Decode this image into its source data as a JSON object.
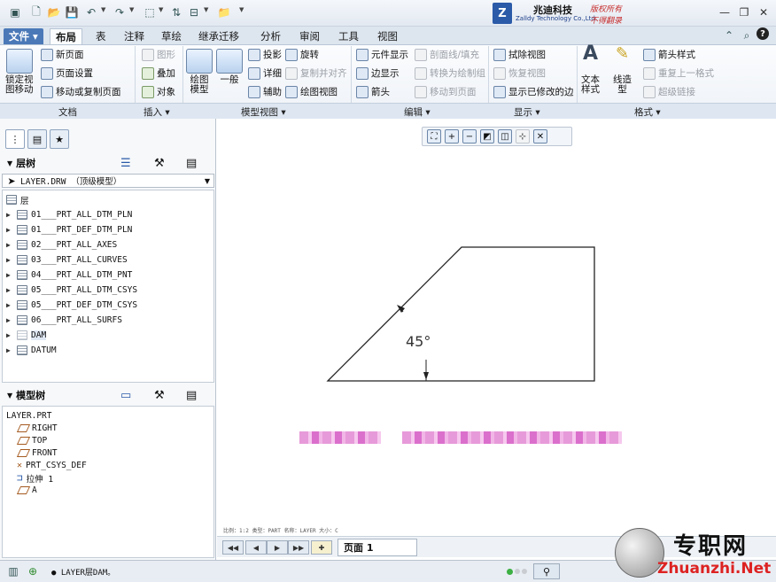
{
  "titlebar": {
    "quick_access": [
      "app-icon",
      "new-icon",
      "open-icon",
      "save-icon",
      "undo-icon",
      "redo-icon",
      "select-box-icon",
      "regenerate-icon",
      "windows-icon",
      "close-window-icon",
      "customize-icon"
    ],
    "logo": {
      "mark": "Z",
      "company_cn": "兆迪科技",
      "company_en": "Zalldy Technology Co.,Ltd.",
      "copyright1": "版权所有",
      "copyright2": "不得翻录"
    },
    "window_buttons": {
      "minimize": "—",
      "restore": "❐",
      "close": "✕"
    }
  },
  "tabs": [
    "文件 ▾",
    "布局",
    "表",
    "注释",
    "草绘",
    "继承迁移",
    "分析",
    "审阅",
    "工具",
    "视图"
  ],
  "ribbon": {
    "document": {
      "big_label": "锁定视\n图移动",
      "items": [
        "新页面",
        "页面设置",
        "移动或复制页面"
      ],
      "group": "文档"
    },
    "insert": {
      "items": [
        "图形",
        "叠加",
        "对象"
      ],
      "group": "插入 ▾"
    },
    "model_view": {
      "big1": "绘图\n模型",
      "big2": "一般",
      "items_a": [
        "投影",
        "详细",
        "辅助"
      ],
      "items_b": [
        "旋转",
        "复制并对齐",
        "绘图视图"
      ],
      "group": "模型视图 ▾"
    },
    "edit": {
      "items_a": [
        "元件显示",
        "边显示",
        "箭头"
      ],
      "items_b": [
        "剖面线/填充",
        "转换为绘制组",
        "移动到页面"
      ],
      "group": "编辑 ▾"
    },
    "display": {
      "items": [
        "拭除视图",
        "恢复视图",
        "显示已修改的边"
      ],
      "group": "显示 ▾"
    },
    "format": {
      "big1": "文本\n样式",
      "big2": "线造\n型",
      "items": [
        "箭头样式",
        "重复上一格式",
        "超级链接"
      ],
      "group": "格式 ▾"
    }
  },
  "layer_tree": {
    "title": "层树",
    "selector": "LAYER.DRW （顶级模型）",
    "root": "层",
    "items": [
      "01___PRT_ALL_DTM_PLN",
      "01___PRT_DEF_DTM_PLN",
      "02___PRT_ALL_AXES",
      "03___PRT_ALL_CURVES",
      "04___PRT_ALL_DTM_PNT",
      "05___PRT_ALL_DTM_CSYS",
      "05___PRT_DEF_DTM_CSYS",
      "06___PRT_ALL_SURFS",
      "DAM",
      "DATUM"
    ]
  },
  "model_tree": {
    "title": "模型树",
    "root": "LAYER.PRT",
    "items": [
      "RIGHT",
      "TOP",
      "FRONT",
      "PRT_CSYS_DEF",
      "拉伸 1",
      "A"
    ]
  },
  "drawing": {
    "angle_label": "45°"
  },
  "page": {
    "info_line": "比例：1:2    类型：PART    名称：LAYER    大小：C",
    "page_label": "页面 1"
  },
  "status": {
    "message": "● LAYER层DAM。"
  },
  "watermark": {
    "cn": "专职网",
    "url": "Zhuanzhi.Net"
  }
}
